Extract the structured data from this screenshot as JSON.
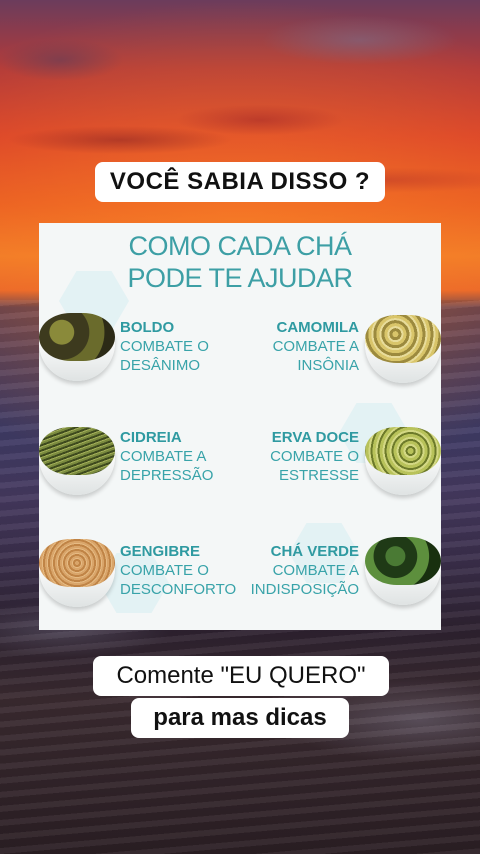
{
  "header": {
    "title": "VOCÊ SABIA DISSO ?"
  },
  "card": {
    "title_line1": "COMO CADA CHÁ",
    "title_line2": "PODE TE AJUDAR",
    "items": [
      {
        "name": "BOLDO",
        "line1": "COMBATE O",
        "line2": "DESÂNIMO"
      },
      {
        "name": "CAMOMILA",
        "line1": "COMBATE A",
        "line2": "INSÔNIA"
      },
      {
        "name": "CIDREIA",
        "line1": "COMBATE A",
        "line2": "DEPRESSÃO"
      },
      {
        "name": "ERVA DOCE",
        "line1": "COMBATE O",
        "line2": "ESTRESSE"
      },
      {
        "name": "GENGIBRE",
        "line1": "COMBATE O",
        "line2": "DESCONFORTO"
      },
      {
        "name": "CHÁ VERDE",
        "line1": "COMBATE A",
        "line2": "INDISPOSIÇÃO"
      }
    ]
  },
  "footer": {
    "cta_line1": "Comente \"EU QUERO\"",
    "cta_line2": "para mas dicas"
  },
  "colors": {
    "accent": "#3d9fa5",
    "card_bg": "#f4f7f7"
  }
}
